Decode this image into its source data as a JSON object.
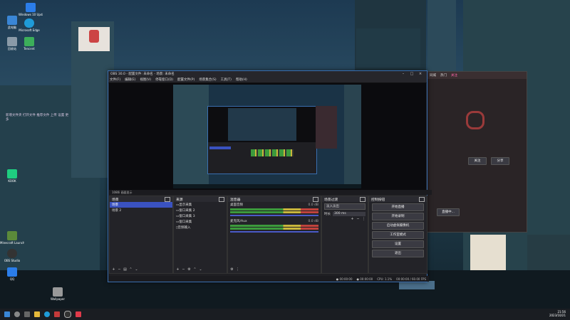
{
  "desktop": {
    "icons": [
      {
        "label": "Windows 10 Update",
        "color": "#2b7de9"
      },
      {
        "label": "此电脑",
        "color": "#3a86d6"
      },
      {
        "label": "Microsoft Edge",
        "color": "#1f9bd8"
      },
      {
        "label": "回收站",
        "color": "#8a9aa8"
      },
      {
        "label": "Tencent",
        "color": "#3cae5a"
      },
      {
        "label": "KOOK",
        "color": "#1fcd80"
      },
      {
        "label": "Minecraft Launcher",
        "color": "#5b8a3a"
      },
      {
        "label": "OBS Studio",
        "color": "#333"
      },
      {
        "label": "QQ",
        "color": "#2b7de9"
      },
      {
        "label": "Wallpaper",
        "color": "#999"
      }
    ],
    "sticky_note": "新增文件夹 打开文件 推荐文件 上传 设置 更多"
  },
  "obs": {
    "title": "OBS 30.0 - 配置文件: 未命名 - 场景: 未命名",
    "menu": [
      "文件(F)",
      "编辑(E)",
      "视图(V)",
      "停靠窗口(D)",
      "配置文件(P)",
      "场景集合(S)",
      "工具(T)",
      "帮助(H)"
    ],
    "preview_tool_label": "1080i  画面显示",
    "scenes": {
      "title": "场景",
      "items": [
        "场景",
        "场景 2"
      ]
    },
    "sources": {
      "title": "来源",
      "items": [
        "显示采集",
        "窗口采集 2",
        "窗口采集 3",
        "窗口采集",
        "音频输入"
      ]
    },
    "mixer": {
      "title": "混音器",
      "channels": [
        {
          "name": "桌面音频",
          "db": "0.0 dB"
        },
        {
          "name": "麦克风/Aux",
          "db": "0.0 dB"
        }
      ]
    },
    "transitions": {
      "title": "场景过渡",
      "type": "淡入淡出",
      "duration_label": "时长",
      "duration": "300 ms"
    },
    "controls": {
      "title": "控制按钮",
      "buttons": [
        "开始直播",
        "开始录制",
        "启动虚拟摄像机",
        "工作室模式",
        "设置",
        "退出"
      ]
    },
    "status": {
      "cpu": "CPU: 1.1%",
      "fps": "00:00:00 / 60.00 FPS",
      "rec": "00:00:00",
      "live": "00:00:00"
    }
  },
  "right_app": {
    "tabs": [
      "同城",
      "热门",
      "关注"
    ],
    "status_text": "直播中...",
    "btn1": "关注",
    "btn2": "分享"
  },
  "taskbar": {
    "time": "21:56",
    "date": "2023/10/21"
  }
}
